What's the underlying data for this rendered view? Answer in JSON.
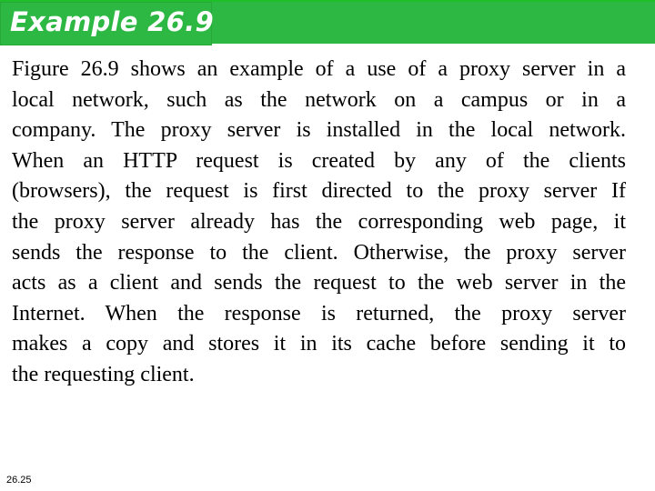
{
  "header": {
    "title": "Example 26.9",
    "accent_color": "#2db743"
  },
  "body": {
    "lines": [
      "Figure 26.9 shows an example of a use of a proxy server in a",
      "local network, such as the network on a campus or in a",
      "company. The proxy server is installed in the local network.",
      "When an HTTP request is created by any of the clients",
      "(browsers), the request is first directed to the proxy server If",
      "the proxy server already has the corresponding web page, it",
      "sends the response to the client. Otherwise, the proxy server",
      "acts as a client and sends the request to the web server in the",
      "Internet. When the response is returned, the proxy server",
      "makes a copy and stores it in its cache before sending it to",
      "the requesting client."
    ]
  },
  "footer": {
    "page_number": "26.25"
  }
}
